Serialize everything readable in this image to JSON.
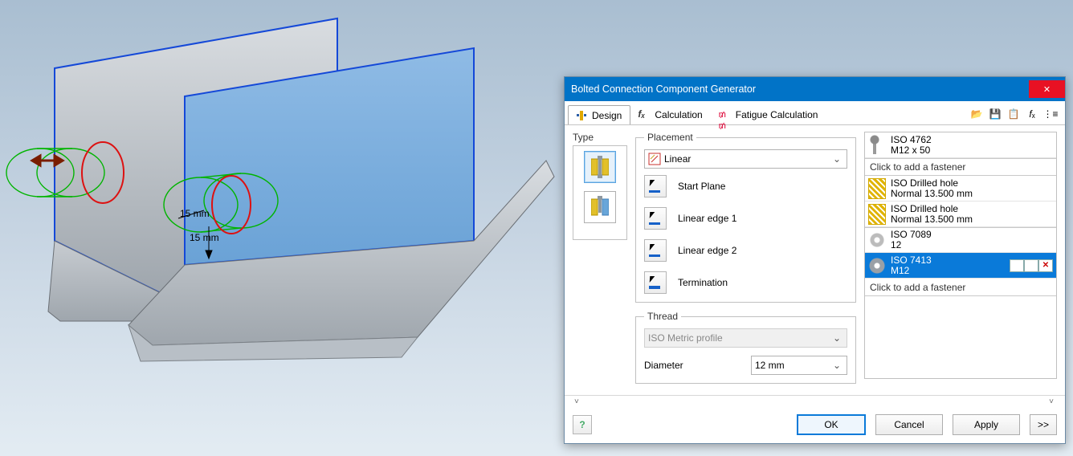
{
  "viewport": {
    "dimension_a": "15 mm",
    "dimension_b": "15 mm"
  },
  "dialog": {
    "title": "Bolted Connection Component Generator",
    "tabs": [
      {
        "label": "Design"
      },
      {
        "label": "Calculation"
      },
      {
        "label": "Fatigue Calculation"
      }
    ],
    "toolbar_icons": [
      "open",
      "save",
      "settings",
      "fx",
      "opts"
    ],
    "type_label": "Type",
    "placement": {
      "legend": "Placement",
      "mode": "Linear",
      "rows": [
        {
          "label": "Start Plane"
        },
        {
          "label": "Linear edge 1"
        },
        {
          "label": "Linear edge 2"
        },
        {
          "label": "Termination"
        }
      ]
    },
    "thread": {
      "legend": "Thread",
      "profile": "ISO Metric profile",
      "diameter_label": "Diameter",
      "diameter_value": "12 mm"
    },
    "right": {
      "top": {
        "line1": "ISO 4762",
        "line2": "M12 x 50"
      },
      "add_click_top": "Click to add a fastener",
      "holes": [
        {
          "line1": "ISO Drilled hole",
          "line2": "Normal 13.500 mm"
        },
        {
          "line1": "ISO Drilled hole",
          "line2": "Normal 13.500 mm"
        }
      ],
      "washer": {
        "line1": "ISO 7089",
        "line2": "12"
      },
      "nut": {
        "line1": "ISO 7413",
        "line2": "M12"
      },
      "add_click_bottom": "Click to add a fastener"
    },
    "footer": {
      "ok": "OK",
      "cancel": "Cancel",
      "apply": "Apply",
      "expand": ">>"
    }
  }
}
